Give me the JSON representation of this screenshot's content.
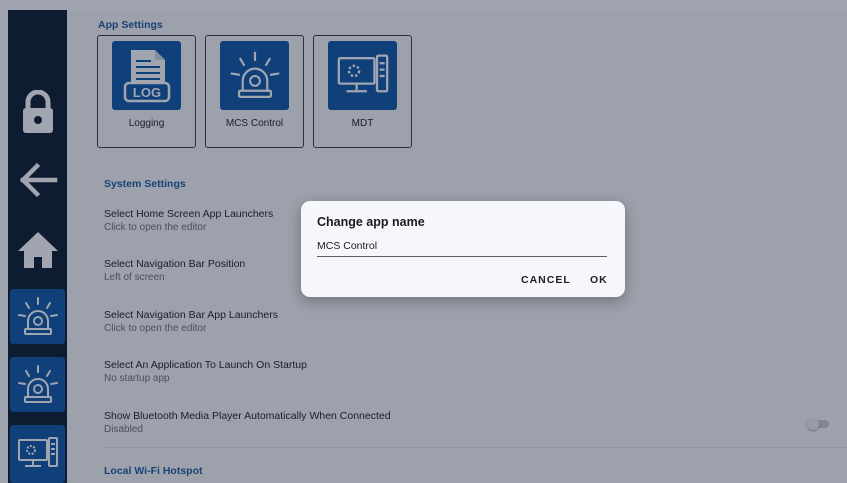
{
  "settings": {
    "app_settings_header": "App Settings",
    "apps": [
      {
        "label": "Logging",
        "icon": "log-file-icon"
      },
      {
        "label": "MCS Control",
        "icon": "beacon-light-icon"
      },
      {
        "label": "MDT",
        "icon": "computer-terminal-icon"
      }
    ],
    "log_icon_text": "LOG",
    "system_settings_header": "System Settings",
    "rows": [
      {
        "title": "Select Home Screen App Launchers",
        "subtitle": "Click to open the editor"
      },
      {
        "title": "Select Navigation Bar Position",
        "subtitle": "Left of screen"
      },
      {
        "title": "Select Navigation Bar App Launchers",
        "subtitle": "Click to open the editor"
      },
      {
        "title": "Select An Application To Launch On Startup",
        "subtitle": "No startup app"
      },
      {
        "title": "Show Bluetooth Media Player Automatically When Connected",
        "subtitle": "Disabled"
      }
    ],
    "bluetooth_toggle_on": false,
    "hotspot_header": "Local Wi-Fi Hotspot"
  },
  "rail": {
    "items": [
      "lock-icon",
      "back-arrow-icon",
      "home-icon",
      "beacon-light-icon",
      "beacon-light-icon",
      "computer-terminal-icon"
    ]
  },
  "dialog": {
    "title": "Change app name",
    "input_value": "MCS Control",
    "cancel_label": "CANCEL",
    "ok_label": "OK"
  },
  "colors": {
    "rail": "#0b1b2f",
    "accent": "#0d57a5",
    "section_header": "#1d5aa0",
    "dialog_bg": "#f5f7fd"
  }
}
